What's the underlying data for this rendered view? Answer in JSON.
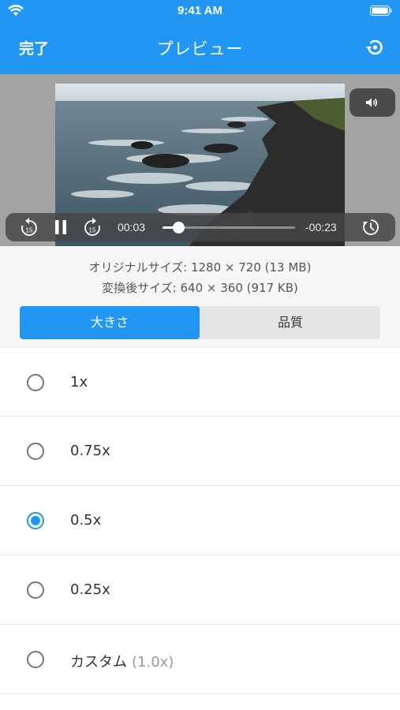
{
  "status_bar": {
    "time": "9:41 AM"
  },
  "nav": {
    "done_label": "完了",
    "title": "プレビュー"
  },
  "player": {
    "current_time": "00:03",
    "remaining_time": "-00:23",
    "progress": 0.12
  },
  "info": {
    "original_size": "オリジナルサイズ: 1280 × 720 (13 MB)",
    "converted_size": "変換後サイズ: 640 × 360 (917 KB)"
  },
  "segments": [
    "大きさ",
    "品質"
  ],
  "options": [
    {
      "label": "1x",
      "sub": "",
      "checked": false
    },
    {
      "label": "0.75x",
      "sub": "",
      "checked": false
    },
    {
      "label": "0.5x",
      "sub": "",
      "checked": true
    },
    {
      "label": "0.25x",
      "sub": "",
      "checked": false
    },
    {
      "label": "カスタム",
      "sub": "(1.0x)",
      "checked": false
    }
  ],
  "colors": {
    "accent": "#2196F3"
  }
}
